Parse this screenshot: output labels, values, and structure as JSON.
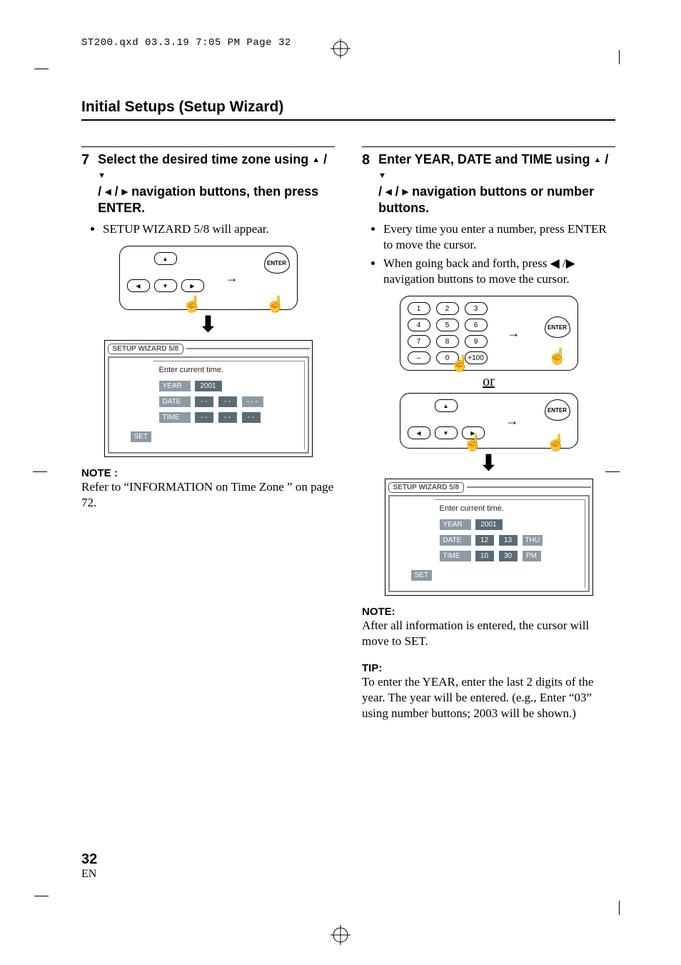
{
  "running_head": "ST200.qxd  03.3.19 7:05 PM  Page 32",
  "section_title": "Initial Setups (Setup Wizard)",
  "step7": {
    "num": "7",
    "text_pre": "Select the desired time zone using ",
    "text_mid": " navigation buttons, then press ENTER.",
    "bullet1": "SETUP WIZARD 5/8 will appear."
  },
  "step8": {
    "num": "8",
    "text_pre": "Enter YEAR, DATE and TIME using ",
    "text_mid": " navigation buttons or number buttons.",
    "bullets": [
      "Every time you enter a number, press ENTER to move the cursor.",
      "When going back and forth, press ◀ /▶ navigation buttons to move the cursor."
    ]
  },
  "enter_label": "ENTER",
  "or_label": "or",
  "screen": {
    "title": "SETUP WIZARD 5/8",
    "caption": "Enter  current  time.",
    "labels": {
      "year": "YEAR",
      "date": "DATE",
      "time": "TIME",
      "set": "SET"
    },
    "blank": {
      "year": "2001",
      "date": [
        "- -",
        "- -",
        "- - -"
      ],
      "time": [
        "- -",
        "- -",
        "- -"
      ]
    },
    "filled": {
      "year": "2001",
      "date": [
        "12",
        "13",
        "THU"
      ],
      "time": [
        "10",
        "30",
        "PM"
      ]
    }
  },
  "numpad": [
    "1",
    "2",
    "3",
    "4",
    "5",
    "6",
    "7",
    "8",
    "9",
    "–",
    "0",
    "+100"
  ],
  "left_note": {
    "label": "NOTE :",
    "text": "Refer to “INFORMATION on Time Zone ” on page 72."
  },
  "right_note": {
    "label": "NOTE:",
    "text": "After all information is entered, the cursor will move to SET."
  },
  "tip": {
    "label": "TIP:",
    "text": "To enter the YEAR, enter the last 2 digits of the year. The year will be entered. (e.g., Enter “03” using number buttons; 2003 will be shown.)"
  },
  "page_number": "32",
  "page_lang": "EN"
}
